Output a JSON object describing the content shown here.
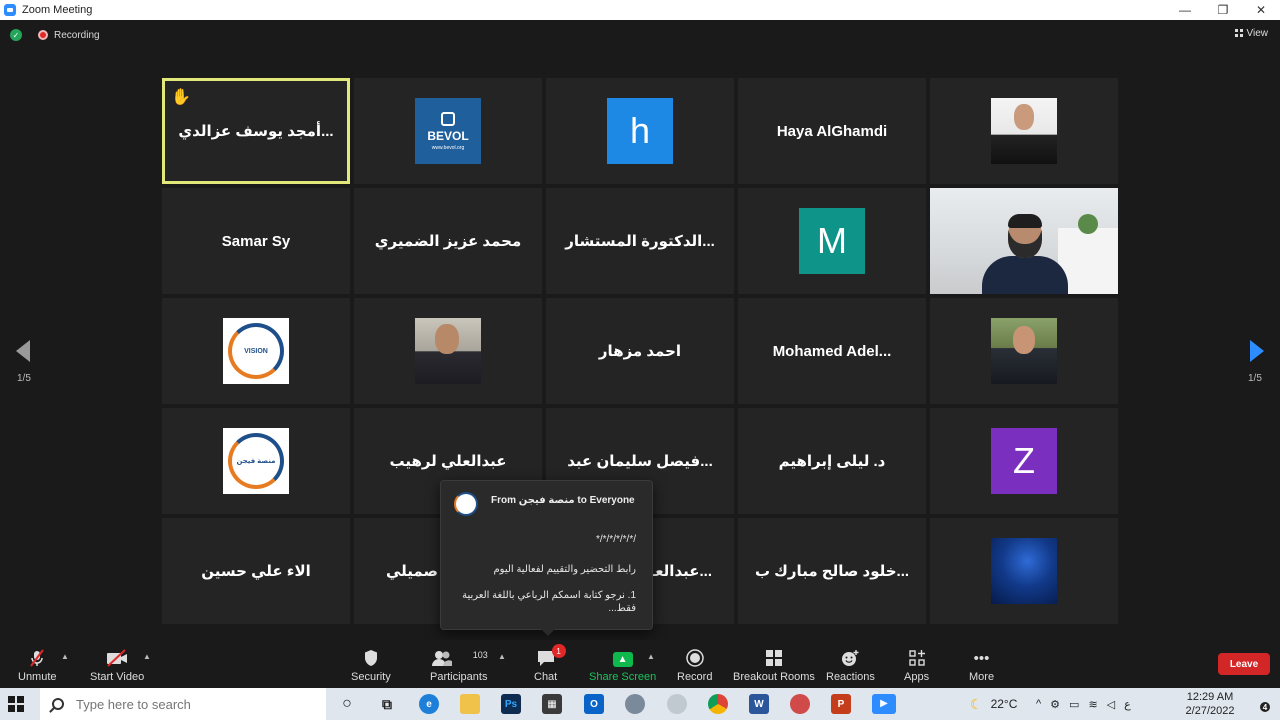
{
  "window": {
    "title": "Zoom Meeting",
    "controls": [
      "—",
      "❐",
      "✕"
    ]
  },
  "topbar": {
    "recording_label": "Recording",
    "view_label": "View"
  },
  "pagination": {
    "left": "1/5",
    "right": "1/5"
  },
  "tiles": [
    {
      "name": "أمجد يوسف عزالدي...",
      "type": "name",
      "active": true,
      "hand_raised": true
    },
    {
      "name": "BEVOL",
      "type": "bevol",
      "url": "www.bevol.org"
    },
    {
      "name": "h",
      "type": "letter",
      "color": "#1e88e5"
    },
    {
      "name": "Haya AlGhamdi",
      "type": "name"
    },
    {
      "name": "",
      "type": "photo-suit"
    },
    {
      "name": "Samar Sy",
      "type": "name"
    },
    {
      "name": "محمد عزيز الضميري",
      "type": "name"
    },
    {
      "name": "الدكتورة المستشار...",
      "type": "name"
    },
    {
      "name": "M",
      "type": "letter",
      "color": "#0e9488"
    },
    {
      "name": "",
      "type": "video"
    },
    {
      "name": "VISION",
      "type": "vision"
    },
    {
      "name": "",
      "type": "photo-man1"
    },
    {
      "name": "احمد مزهار",
      "type": "name"
    },
    {
      "name": "Mohamed  Adel...",
      "type": "name"
    },
    {
      "name": "",
      "type": "photo-man2"
    },
    {
      "name": "منصة فيجن",
      "type": "vision"
    },
    {
      "name": "عبدالعلي لرهيب",
      "type": "name"
    },
    {
      "name": "فيصل سليمان عبد...",
      "type": "name"
    },
    {
      "name": "د. ليلى إبراهيم",
      "type": "name"
    },
    {
      "name": "Z",
      "type": "letter",
      "color": "#7b2fbe"
    },
    {
      "name": "الاء علي حسين",
      "type": "name"
    },
    {
      "name": "صميلي",
      "type": "name-left"
    },
    {
      "name": "عبدالعـ...",
      "type": "name-right"
    },
    {
      "name": "خلود صالح مبارك ب...",
      "type": "name"
    },
    {
      "name": "",
      "type": "photo-night"
    }
  ],
  "chat_popup": {
    "from_line": "From منصة فيجن to Everyone",
    "line1": "/*/*/*/*/*/*",
    "line2": "رابط التحضير والتقييم لفعالية اليوم",
    "line3": "1.  نرجو كتابة اسمكم الرباعي باللغة العربية فقط..."
  },
  "controls": {
    "unmute": "Unmute",
    "start_video": "Start Video",
    "security": "Security",
    "participants": "Participants",
    "participants_count": "103",
    "chat": "Chat",
    "chat_badge": "1",
    "share_screen": "Share Screen",
    "record": "Record",
    "breakout_rooms": "Breakout Rooms",
    "reactions": "Reactions",
    "apps": "Apps",
    "more": "More",
    "leave": "Leave"
  },
  "taskbar": {
    "search_placeholder": "Type here to search",
    "weather": "22°C",
    "lang": "ع",
    "time": "12:29 AM",
    "date": "2/27/2022",
    "notif_count": "4"
  },
  "colors": {
    "accent": "#2d8cff",
    "share_green": "#0eb84d",
    "leave_red": "#d32626",
    "active_border": "#e3e87a"
  }
}
